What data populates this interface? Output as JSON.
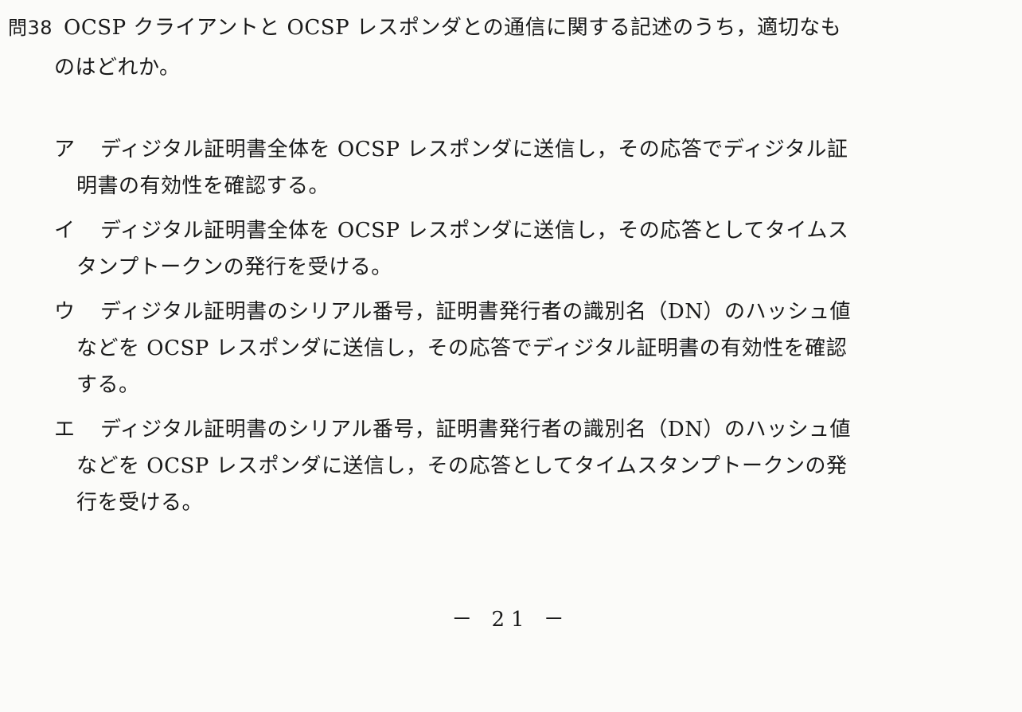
{
  "question": {
    "number": "問38",
    "line1": "OCSP クライアントと OCSP レスポンダとの通信に関する記述のうち，適切なも",
    "line2": "のはどれか。"
  },
  "choices": [
    {
      "label": "ア",
      "lines": [
        "ディジタル証明書全体を OCSP レスポンダに送信し，その応答でディジタル証",
        "明書の有効性を確認する。"
      ]
    },
    {
      "label": "イ",
      "lines": [
        "ディジタル証明書全体を OCSP レスポンダに送信し，その応答としてタイムス",
        "タンプトークンの発行を受ける。"
      ]
    },
    {
      "label": "ウ",
      "lines": [
        "ディジタル証明書のシリアル番号，証明書発行者の識別名（DN）のハッシュ値",
        "などを OCSP レスポンダに送信し，その応答でディジタル証明書の有効性を確認",
        "する。"
      ]
    },
    {
      "label": "エ",
      "lines": [
        "ディジタル証明書のシリアル番号，証明書発行者の識別名（DN）のハッシュ値",
        "などを OCSP レスポンダに送信し，その応答としてタイムスタンプトークンの発",
        "行を受ける。"
      ]
    }
  ],
  "page_number": "－ 21 －"
}
